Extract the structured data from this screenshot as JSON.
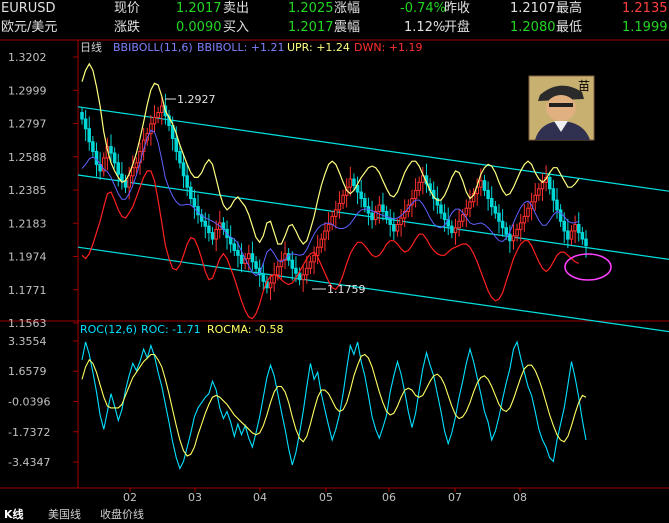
{
  "quote": {
    "symbol": "EURUSD",
    "name": "欧元/美元",
    "xianjia_label": "现价",
    "xianjia": "1.2017",
    "maichu_label": "卖出",
    "maichu": "1.2025",
    "zhangfu_label": "涨幅",
    "zhangfu": "-0.74%",
    "zuoshou_label": "昨收",
    "zuoshou": "1.2107",
    "zuigao_label": "最高",
    "zuigao": "1.2135",
    "zhangdie_label": "涨跌",
    "zhangdie": "0.0090",
    "mairu_label": "买入",
    "mairu": "1.2017",
    "zhenfu_label": "震幅",
    "zhenfu": "1.12%",
    "kaipan_label": "开盘",
    "kaipan": "1.2080",
    "zuidi_label": "最低",
    "zuidi": "1.1999"
  },
  "avatar": {
    "char": "苗",
    "icon": "trader-avatar-icon"
  },
  "main_legend": {
    "period": "日线",
    "boll": "BBIBOLL(11,6)",
    "boll_val": "BBIBOLL: +1.21",
    "upr": "UPR: +1.24",
    "dwn": "DWN: +1.19"
  },
  "roc_legend": {
    "name": "ROC(12,6)",
    "roc": "ROC: -1.71",
    "rocma": "ROCMA: -0.58"
  },
  "annotations": {
    "high": "1.2927",
    "low": "1.1759"
  },
  "tabs": [
    "K线",
    "美国线",
    "收盘价线"
  ],
  "colors": {
    "up": "#ff3030",
    "down": "#00d8d8",
    "upper": "#ffff80",
    "lower": "#ff2020",
    "mid": "#6060ff",
    "channel": "#00e0e0",
    "roc": "#00e0ff",
    "rocma": "#ffff60",
    "ellipse": "#ff40ff"
  },
  "chart_data": [
    {
      "type": "candlestick",
      "yticks": [
        "1.3202",
        "1.2999",
        "1.2797",
        "1.2588",
        "1.2385",
        "1.2183",
        "1.1974",
        "1.1771",
        "1.1563"
      ],
      "xticks": [
        "02",
        "03",
        "04",
        "05",
        "06",
        "07",
        "08"
      ],
      "ylim": [
        1.1563,
        1.3202
      ],
      "close": [
        1.282,
        1.276,
        1.268,
        1.262,
        1.254,
        1.25,
        1.258,
        1.265,
        1.261,
        1.255,
        1.248,
        1.244,
        1.24,
        1.247,
        1.252,
        1.255,
        1.262,
        1.269,
        1.273,
        1.279,
        1.283,
        1.286,
        1.29,
        1.284,
        1.278,
        1.27,
        1.262,
        1.255,
        1.247,
        1.24,
        1.233,
        1.228,
        1.223,
        1.219,
        1.216,
        1.212,
        1.208,
        1.214,
        1.218,
        1.214,
        1.209,
        1.205,
        1.201,
        1.198,
        1.193,
        1.196,
        1.199,
        1.194,
        1.19,
        1.186,
        1.182,
        1.178,
        1.181,
        1.186,
        1.191,
        1.195,
        1.199,
        1.195,
        1.19,
        1.187,
        1.183,
        1.186,
        1.19,
        1.194,
        1.198,
        1.203,
        1.208,
        1.213,
        1.217,
        1.222,
        1.226,
        1.23,
        1.235,
        1.24,
        1.245,
        1.241,
        1.237,
        1.233,
        1.228,
        1.224,
        1.22,
        1.225,
        1.229,
        1.225,
        1.221,
        1.217,
        1.213,
        1.217,
        1.221,
        1.225,
        1.229,
        1.233,
        1.238,
        1.243,
        1.247,
        1.242,
        1.238,
        1.233,
        1.229,
        1.224,
        1.22,
        1.216,
        1.212,
        1.215,
        1.219,
        1.223,
        1.227,
        1.231,
        1.236,
        1.24,
        1.244,
        1.238,
        1.233,
        1.228,
        1.224,
        1.219,
        1.215,
        1.211,
        1.207,
        1.21,
        1.214,
        1.218,
        1.222,
        1.227,
        1.231,
        1.235,
        1.239,
        1.243,
        1.246,
        1.239,
        1.232,
        1.226,
        1.219,
        1.213,
        1.208,
        1.213,
        1.217,
        1.212,
        1.208,
        1.204
      ],
      "upper": [
        1.305,
        1.312,
        1.316,
        1.312,
        1.302,
        1.29,
        1.274,
        1.263,
        1.255,
        1.25,
        1.246,
        1.243,
        1.244,
        1.248,
        1.254,
        1.261,
        1.27,
        1.28,
        1.291,
        1.3,
        1.304,
        1.303,
        1.296,
        1.287,
        1.283,
        1.279,
        1.273,
        1.266,
        1.26,
        1.254,
        1.249,
        1.246,
        1.246,
        1.249,
        1.254,
        1.257,
        1.254,
        1.245,
        1.236,
        1.229,
        1.226,
        1.228,
        1.232,
        1.234,
        1.231,
        1.228,
        1.223,
        1.216,
        1.209,
        1.206,
        1.21,
        1.218,
        1.219,
        1.212,
        1.205,
        1.205,
        1.21,
        1.216,
        1.217,
        1.213,
        1.208,
        1.205,
        1.207,
        1.214,
        1.222,
        1.232,
        1.241,
        1.248,
        1.254,
        1.256,
        1.254,
        1.249,
        1.243,
        1.238,
        1.236,
        1.238,
        1.242,
        1.246,
        1.249,
        1.252,
        1.253,
        1.252,
        1.249,
        1.244,
        1.239,
        1.235,
        1.234,
        1.237,
        1.243,
        1.249,
        1.253,
        1.256,
        1.256,
        1.253,
        1.248,
        1.243,
        1.238,
        1.234,
        1.232,
        1.232,
        1.235,
        1.24,
        1.246,
        1.25,
        1.249,
        1.244,
        1.237,
        1.233,
        1.235,
        1.241,
        1.248,
        1.252,
        1.254,
        1.253,
        1.249,
        1.243,
        1.238,
        1.235,
        1.236,
        1.24,
        1.245,
        1.25,
        1.254,
        1.256,
        1.254,
        1.249,
        1.245,
        1.243,
        1.245,
        1.249,
        1.252,
        1.252,
        1.248,
        1.244,
        1.24,
        1.24,
        1.242,
        1.245
      ],
      "lower": [
        1.198,
        1.196,
        1.199,
        1.205,
        1.212,
        1.219,
        1.228,
        1.236,
        1.237,
        1.232,
        1.226,
        1.222,
        1.221,
        1.224,
        1.228,
        1.234,
        1.24,
        1.246,
        1.25,
        1.25,
        1.244,
        1.232,
        1.218,
        1.204,
        1.196,
        1.19,
        1.189,
        1.192,
        1.198,
        1.205,
        1.209,
        1.208,
        1.203,
        1.196,
        1.188,
        1.183,
        1.184,
        1.19,
        1.196,
        1.199,
        1.196,
        1.19,
        1.184,
        1.177,
        1.17,
        1.164,
        1.16,
        1.159,
        1.162,
        1.168,
        1.176,
        1.182,
        1.185,
        1.186,
        1.185,
        1.183,
        1.181,
        1.18,
        1.181,
        1.184,
        1.188,
        1.192,
        1.196,
        1.199,
        1.2,
        1.197,
        1.192,
        1.187,
        1.182,
        1.178,
        1.177,
        1.18,
        1.186,
        1.193,
        1.199,
        1.203,
        1.206,
        1.206,
        1.204,
        1.201,
        1.198,
        1.197,
        1.198,
        1.201,
        1.205,
        1.207,
        1.207,
        1.205,
        1.202,
        1.2,
        1.201,
        1.204,
        1.208,
        1.211,
        1.211,
        1.208,
        1.204,
        1.201,
        1.199,
        1.198,
        1.198,
        1.2,
        1.202,
        1.203,
        1.204,
        1.205,
        1.205,
        1.203,
        1.199,
        1.194,
        1.188,
        1.182,
        1.176,
        1.172,
        1.17,
        1.171,
        1.175,
        1.182,
        1.189,
        1.196,
        1.201,
        1.205,
        1.207,
        1.207,
        1.204,
        1.199,
        1.194,
        1.19,
        1.188,
        1.19,
        1.194,
        1.198,
        1.2,
        1.2,
        1.198,
        1.196,
        1.194,
        1.193
      ],
      "channel_top": [
        1.2895,
        1.2375
      ],
      "channel_mid": [
        1.2475,
        1.1955
      ],
      "channel_bot": [
        1.203,
        1.151
      ]
    },
    {
      "type": "line",
      "yticks": [
        "3.3554",
        "1.6579",
        "-0.0396",
        "-1.7372",
        "-3.4347"
      ],
      "ylim": [
        -4.0,
        4.0
      ],
      "series": [
        {
          "name": "ROC",
          "values": [
            2.3,
            3.3,
            2.6,
            1.6,
            0.5,
            -0.8,
            -1.6,
            -0.6,
            0.4,
            -0.3,
            -1.1,
            -0.5,
            0.6,
            1.4,
            2.1,
            1.7,
            2.2,
            2.9,
            2.4,
            3.1,
            2.5,
            1.6,
            0.8,
            -0.2,
            -1.2,
            -2.3,
            -3.2,
            -3.8,
            -3.4,
            -2.6,
            -1.8,
            -0.9,
            -0.4,
            -0.1,
            0.2,
            0.4,
            1.1,
            0.6,
            -0.4,
            -1.0,
            -0.6,
            -1.2,
            -2.0,
            -1.3,
            -1.9,
            -1.4,
            -2.1,
            -2.6,
            -1.8,
            -0.9,
            0.2,
            1.3,
            2.0,
            1.4,
            0.4,
            -0.6,
            -1.6,
            -2.7,
            -3.6,
            -2.9,
            -1.8,
            -0.6,
            0.8,
            2.1,
            1.2,
            1.6,
            0.4,
            -0.5,
            -1.4,
            -2.2,
            -1.6,
            -0.8,
            0.4,
            1.8,
            3.1,
            2.6,
            3.3,
            2.2,
            1.4,
            0.3,
            -0.9,
            -1.6,
            -2.1,
            -1.5,
            -0.8,
            0.5,
            1.4,
            2.2,
            1.5,
            0.5,
            -0.6,
            -1.5,
            -0.7,
            0.6,
            1.8,
            2.7,
            2.0,
            1.4,
            0.4,
            -0.6,
            -1.7,
            -2.4,
            -1.8,
            -0.9,
            0.2,
            1.1,
            2.1,
            2.9,
            2.2,
            1.3,
            0.4,
            -0.6,
            -1.2,
            -2.2,
            -1.7,
            -0.9,
            0.1,
            1.0,
            1.8,
            2.9,
            3.3,
            2.4,
            1.6,
            0.8,
            0.3,
            -0.6,
            -1.6,
            -2.2,
            -2.6,
            -3.2,
            -3.4,
            -2.2,
            -1.3,
            -0.4,
            0.9,
            2.2,
            1.3,
            0.2,
            -1.1,
            -2.2
          ]
        },
        {
          "name": "ROCMA",
          "values": [
            1.2,
            1.9,
            2.3,
            2.1,
            1.6,
            0.9,
            0.2,
            -0.3,
            -0.4,
            -0.4,
            -0.4,
            -0.2,
            0.3,
            0.8,
            1.3,
            1.6,
            1.9,
            2.2,
            2.4,
            2.6,
            2.6,
            2.3,
            1.9,
            1.2,
            0.4,
            -0.5,
            -1.4,
            -2.2,
            -2.8,
            -3.1,
            -3.0,
            -2.6,
            -1.9,
            -1.3,
            -0.7,
            -0.2,
            0.2,
            0.3,
            0.2,
            0.0,
            -0.2,
            -0.5,
            -0.8,
            -1.0,
            -1.2,
            -1.4,
            -1.6,
            -1.8,
            -1.9,
            -1.8,
            -1.4,
            -0.8,
            -0.1,
            0.5,
            0.8,
            0.8,
            0.5,
            -0.1,
            -0.9,
            -1.6,
            -2.1,
            -2.3,
            -2.0,
            -1.3,
            -0.5,
            0.2,
            0.6,
            0.6,
            0.4,
            0.0,
            -0.4,
            -0.6,
            -0.5,
            -0.1,
            0.6,
            1.4,
            2.0,
            2.5,
            2.6,
            2.4,
            1.9,
            1.2,
            0.5,
            -0.1,
            -0.6,
            -0.8,
            -0.7,
            -0.3,
            0.2,
            0.6,
            0.7,
            0.6,
            0.3,
            0.2,
            0.3,
            0.7,
            1.1,
            1.4,
            1.5,
            1.3,
            0.9,
            0.3,
            -0.3,
            -0.8,
            -1.0,
            -0.9,
            -0.6,
            -0.1,
            0.5,
            1.0,
            1.3,
            1.4,
            1.2,
            0.8,
            0.3,
            -0.2,
            -0.5,
            -0.6,
            -0.4,
            0.1,
            0.7,
            1.3,
            1.8,
            2.0,
            2.0,
            1.7,
            1.2,
            0.6,
            -0.1,
            -0.8,
            -1.4,
            -1.9,
            -2.2,
            -2.3,
            -2.0,
            -1.4,
            -0.7,
            -0.1,
            0.3,
            0.2
          ]
        }
      ]
    }
  ]
}
